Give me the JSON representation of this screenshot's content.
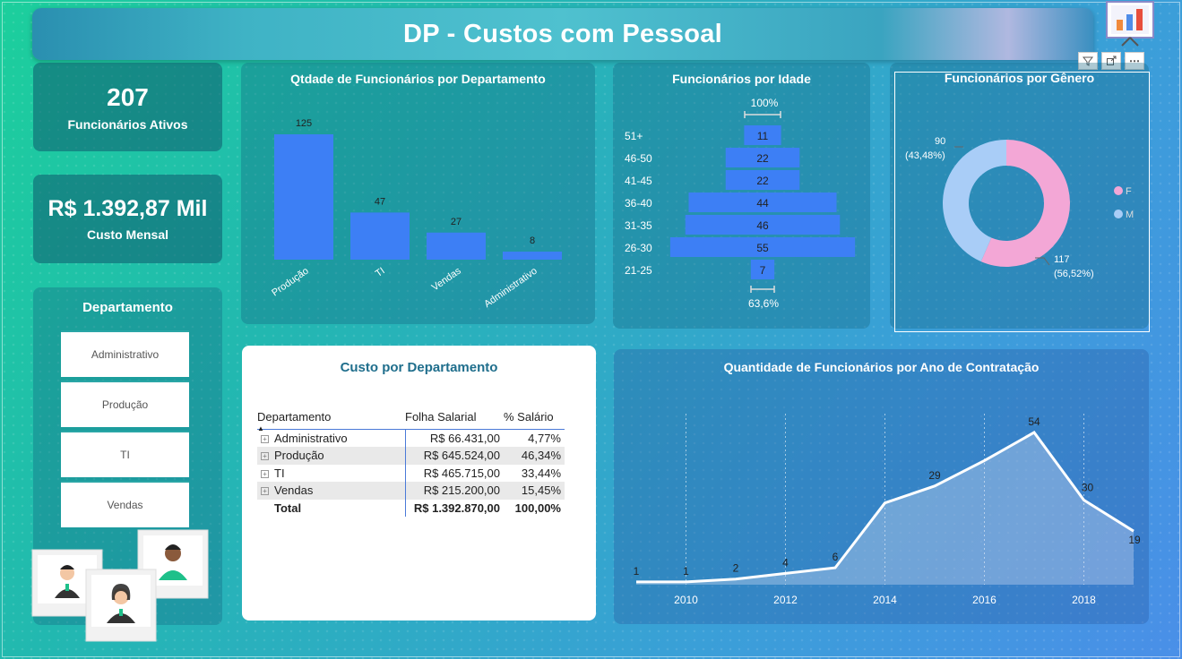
{
  "header": {
    "title": "DP - Custos com Pessoal"
  },
  "toolbar": {
    "filter_icon": "filter-icon",
    "focus_icon": "focus-mode-icon",
    "more_icon": "more-options-icon"
  },
  "kpis": {
    "employees": {
      "value": "207",
      "label": "Funcionários Ativos"
    },
    "cost": {
      "value": "R$ 1.392,87 Mil",
      "label": "Custo Mensal"
    }
  },
  "slicer": {
    "title": "Departamento",
    "items": [
      "Administrativo",
      "Produção",
      "TI",
      "Vendas"
    ]
  },
  "dept_chart": {
    "title": "Qtdade de Funcionários por Departamento",
    "chart_data": {
      "type": "bar",
      "categories": [
        "Produção",
        "TI",
        "Vendas",
        "Administrativo"
      ],
      "values": [
        125,
        47,
        27,
        8
      ],
      "color": "#3d7ff5"
    }
  },
  "age_chart": {
    "title": "Funcionários por Idade",
    "top_label": "100%",
    "bottom_label": "63,6%",
    "chart_data": {
      "type": "bar",
      "categories": [
        "51+",
        "46-50",
        "41-45",
        "36-40",
        "31-35",
        "26-30",
        "21-25"
      ],
      "values": [
        11,
        22,
        22,
        44,
        46,
        55,
        7
      ],
      "color": "#3d7ff5"
    }
  },
  "gender_chart": {
    "title": "Funcionários por Gênero",
    "legend": [
      {
        "label": "F",
        "color": "#f3a7d6"
      },
      {
        "label": "M",
        "color": "#a9cdf7"
      }
    ],
    "chart_data": {
      "type": "pie",
      "slices": [
        {
          "label": "F",
          "value": 117,
          "percent": "56,52%"
        },
        {
          "label": "M",
          "value": 90,
          "percent": "43,48%"
        }
      ]
    },
    "label_f_value": "117",
    "label_f_pct": "(56,52%)",
    "label_m_value": "90",
    "label_m_pct": "(43,48%)"
  },
  "cost_table": {
    "title": "Custo por Departamento",
    "columns": [
      "Departamento",
      "Folha Salarial",
      "% Salário"
    ],
    "rows": [
      {
        "dept": "Administrativo",
        "folha": "R$ 66.431,00",
        "pct": "4,77%"
      },
      {
        "dept": "Produção",
        "folha": "R$ 645.524,00",
        "pct": "46,34%"
      },
      {
        "dept": "TI",
        "folha": "R$ 465.715,00",
        "pct": "33,44%"
      },
      {
        "dept": "Vendas",
        "folha": "R$ 215.200,00",
        "pct": "15,45%"
      }
    ],
    "total": {
      "label": "Total",
      "folha": "R$ 1.392.870,00",
      "pct": "100,00%"
    }
  },
  "hire_chart": {
    "title": "Quantidade de Funcionários por Ano de Contratação",
    "chart_data": {
      "type": "area",
      "x": [
        2009,
        2010,
        2011,
        2012,
        2013,
        2014,
        2015,
        2016,
        2017,
        2018,
        2019
      ],
      "values": [
        1,
        1,
        2,
        4,
        6,
        29,
        35,
        44,
        54,
        30,
        19
      ],
      "labels_shown": {
        "2009": "1",
        "2010": "1",
        "2011": "2",
        "2012": "4",
        "2013": "6",
        "2015": "29",
        "2017": "54",
        "2018": "30",
        "2019": "19"
      },
      "x_ticks": [
        2010,
        2012,
        2014,
        2016,
        2018
      ],
      "ylim": [
        0,
        60
      ]
    }
  }
}
